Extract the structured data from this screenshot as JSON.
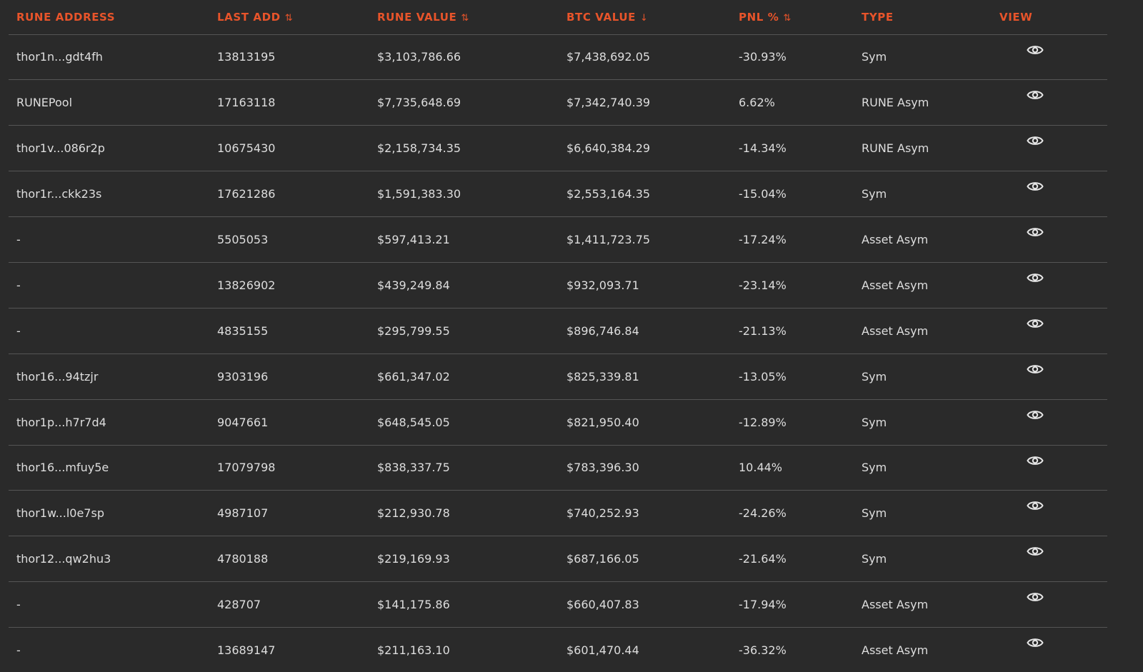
{
  "colors": {
    "background": "#2a2a2a",
    "accent": "#e8542a",
    "text": "#dedede",
    "divider": "#555555"
  },
  "columns": [
    {
      "label": "RUNE ADDRESS",
      "sort": ""
    },
    {
      "label": "LAST ADD",
      "sort": "⇅"
    },
    {
      "label": "RUNE VALUE",
      "sort": "⇅"
    },
    {
      "label": "BTC VALUE",
      "sort": "↓"
    },
    {
      "label": "PNL %",
      "sort": "⇅"
    },
    {
      "label": "TYPE",
      "sort": ""
    },
    {
      "label": "VIEW",
      "sort": ""
    }
  ],
  "rows": [
    {
      "address": "thor1n...gdt4fh",
      "last_add": "13813195",
      "rune_value": "$3,103,786.66",
      "btc_value": "$7,438,692.05",
      "pnl": "-30.93%",
      "type": "Sym",
      "view_icon": "eye-icon"
    },
    {
      "address": "RUNEPool",
      "last_add": "17163118",
      "rune_value": "$7,735,648.69",
      "btc_value": "$7,342,740.39",
      "pnl": "6.62%",
      "type": "RUNE Asym",
      "view_icon": "eye-icon"
    },
    {
      "address": "thor1v...086r2p",
      "last_add": "10675430",
      "rune_value": "$2,158,734.35",
      "btc_value": "$6,640,384.29",
      "pnl": "-14.34%",
      "type": "RUNE Asym",
      "view_icon": "eye-icon"
    },
    {
      "address": "thor1r...ckk23s",
      "last_add": "17621286",
      "rune_value": "$1,591,383.30",
      "btc_value": "$2,553,164.35",
      "pnl": "-15.04%",
      "type": "Sym",
      "view_icon": "eye-icon"
    },
    {
      "address": "-",
      "last_add": "5505053",
      "rune_value": "$597,413.21",
      "btc_value": "$1,411,723.75",
      "pnl": "-17.24%",
      "type": "Asset Asym",
      "view_icon": "eye-icon"
    },
    {
      "address": "-",
      "last_add": "13826902",
      "rune_value": "$439,249.84",
      "btc_value": "$932,093.71",
      "pnl": "-23.14%",
      "type": "Asset Asym",
      "view_icon": "eye-icon"
    },
    {
      "address": "-",
      "last_add": "4835155",
      "rune_value": "$295,799.55",
      "btc_value": "$896,746.84",
      "pnl": "-21.13%",
      "type": "Asset Asym",
      "view_icon": "eye-icon"
    },
    {
      "address": "thor16...94tzjr",
      "last_add": "9303196",
      "rune_value": "$661,347.02",
      "btc_value": "$825,339.81",
      "pnl": "-13.05%",
      "type": "Sym",
      "view_icon": "eye-icon"
    },
    {
      "address": "thor1p...h7r7d4",
      "last_add": "9047661",
      "rune_value": "$648,545.05",
      "btc_value": "$821,950.40",
      "pnl": "-12.89%",
      "type": "Sym",
      "view_icon": "eye-icon"
    },
    {
      "address": "thor16...mfuy5e",
      "last_add": "17079798",
      "rune_value": "$838,337.75",
      "btc_value": "$783,396.30",
      "pnl": "10.44%",
      "type": "Sym",
      "view_icon": "eye-icon"
    },
    {
      "address": "thor1w...l0e7sp",
      "last_add": "4987107",
      "rune_value": "$212,930.78",
      "btc_value": "$740,252.93",
      "pnl": "-24.26%",
      "type": "Sym",
      "view_icon": "eye-icon"
    },
    {
      "address": "thor12...qw2hu3",
      "last_add": "4780188",
      "rune_value": "$219,169.93",
      "btc_value": "$687,166.05",
      "pnl": "-21.64%",
      "type": "Sym",
      "view_icon": "eye-icon"
    },
    {
      "address": "-",
      "last_add": "428707",
      "rune_value": "$141,175.86",
      "btc_value": "$660,407.83",
      "pnl": "-17.94%",
      "type": "Asset Asym",
      "view_icon": "eye-icon"
    },
    {
      "address": "-",
      "last_add": "13689147",
      "rune_value": "$211,163.10",
      "btc_value": "$601,470.44",
      "pnl": "-36.32%",
      "type": "Asset Asym",
      "view_icon": "eye-icon"
    }
  ]
}
